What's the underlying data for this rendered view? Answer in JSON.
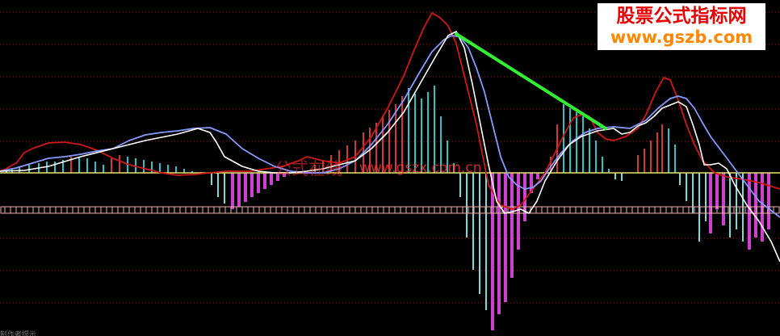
{
  "brand": {
    "name": "股票公式指标网",
    "url": "www.gszb.com"
  },
  "watermark": {
    "text_cn": "公式在线",
    "url": "www.gszx.com.cn"
  },
  "bottom_fragment": "制作者提示",
  "colors": {
    "background": "#000000",
    "kline_red": "#d01818",
    "dea_blue": "#8899ff",
    "dif_white": "#ffffff",
    "trend_green": "#33ee33",
    "zero_line": "#e8e070",
    "band": "#f0b0b0",
    "bar_pos_cyan": "#30c0c8",
    "bar_neg_magenta": "#d040d0",
    "bar_pos_red": "#cc3a3a",
    "bar_neg_cyan": "#7fd8d8",
    "grid": "#8a2020"
  },
  "chart_data": {
    "type": "line",
    "title": "",
    "xlabel": "",
    "ylabel": "",
    "grid": "dotted horizontal red lines",
    "x_count": 120,
    "ylim": [
      -100,
      100
    ],
    "zero_line": 0,
    "series": [
      {
        "name": "",
        "color": "#d01818",
        "points": [
          [
            0,
            2
          ],
          [
            8,
            5
          ],
          [
            12,
            8
          ],
          [
            20,
            12
          ],
          [
            30,
            25
          ],
          [
            40,
            30
          ],
          [
            60,
            37
          ],
          [
            80,
            38
          ],
          [
            100,
            35
          ],
          [
            120,
            28
          ],
          [
            140,
            18
          ],
          [
            160,
            10
          ],
          [
            180,
            5
          ],
          [
            200,
            0
          ],
          [
            220,
            -3
          ],
          [
            240,
            -2
          ],
          [
            260,
            0
          ],
          [
            280,
            2
          ],
          [
            310,
            2
          ],
          [
            330,
            5
          ],
          [
            350,
            8
          ],
          [
            370,
            15
          ],
          [
            380,
            20
          ],
          [
            400,
            15
          ],
          [
            420,
            12
          ],
          [
            440,
            20
          ],
          [
            460,
            45
          ],
          [
            480,
            80
          ],
          [
            500,
            120
          ],
          [
            512,
            150
          ],
          [
            525,
            180
          ],
          [
            535,
            198
          ],
          [
            545,
            192
          ],
          [
            555,
            182
          ],
          [
            565,
            160
          ],
          [
            575,
            120
          ],
          [
            590,
            60
          ],
          [
            605,
            -15
          ],
          [
            620,
            -40
          ],
          [
            635,
            -45
          ],
          [
            645,
            -40
          ],
          [
            660,
            -20
          ],
          [
            675,
            0
          ],
          [
            690,
            30
          ],
          [
            700,
            50
          ],
          [
            710,
            68
          ],
          [
            720,
            72
          ],
          [
            730,
            70
          ],
          [
            740,
            50
          ],
          [
            750,
            42
          ],
          [
            760,
            40
          ],
          [
            775,
            45
          ],
          [
            790,
            55
          ],
          [
            800,
            72
          ],
          [
            812,
            100
          ],
          [
            822,
            118
          ],
          [
            830,
            115
          ],
          [
            840,
            90
          ],
          [
            850,
            60
          ],
          [
            860,
            35
          ],
          [
            870,
            15
          ],
          [
            885,
            0
          ],
          [
            900,
            -5
          ],
          [
            920,
            -8
          ],
          [
            940,
            -12
          ],
          [
            966,
            -20
          ]
        ]
      },
      {
        "name": "",
        "color": "#8899ff",
        "points": [
          [
            0,
            2
          ],
          [
            20,
            6
          ],
          [
            40,
            12
          ],
          [
            60,
            18
          ],
          [
            80,
            20
          ],
          [
            100,
            23
          ],
          [
            120,
            27
          ],
          [
            140,
            30
          ],
          [
            160,
            40
          ],
          [
            180,
            47
          ],
          [
            200,
            50
          ],
          [
            220,
            52
          ],
          [
            240,
            55
          ],
          [
            260,
            56
          ],
          [
            280,
            48
          ],
          [
            300,
            30
          ],
          [
            320,
            18
          ],
          [
            340,
            8
          ],
          [
            360,
            2
          ],
          [
            380,
            0
          ],
          [
            400,
            0
          ],
          [
            420,
            5
          ],
          [
            440,
            15
          ],
          [
            460,
            35
          ],
          [
            480,
            60
          ],
          [
            500,
            90
          ],
          [
            520,
            125
          ],
          [
            535,
            150
          ],
          [
            550,
            165
          ],
          [
            560,
            170
          ],
          [
            570,
            168
          ],
          [
            580,
            155
          ],
          [
            590,
            130
          ],
          [
            600,
            100
          ],
          [
            610,
            60
          ],
          [
            620,
            20
          ],
          [
            630,
            -5
          ],
          [
            640,
            -15
          ],
          [
            650,
            -20
          ],
          [
            660,
            -18
          ],
          [
            670,
            -10
          ],
          [
            680,
            5
          ],
          [
            695,
            25
          ],
          [
            710,
            40
          ],
          [
            725,
            50
          ],
          [
            740,
            55
          ],
          [
            760,
            57
          ],
          [
            780,
            55
          ],
          [
            800,
            65
          ],
          [
            815,
            80
          ],
          [
            830,
            92
          ],
          [
            840,
            95
          ],
          [
            850,
            92
          ],
          [
            860,
            80
          ],
          [
            870,
            62
          ],
          [
            880,
            45
          ],
          [
            895,
            25
          ],
          [
            910,
            5
          ],
          [
            925,
            -15
          ],
          [
            940,
            -35
          ],
          [
            966,
            -55
          ]
        ]
      },
      {
        "name": "",
        "color": "#ffffff",
        "points": [
          [
            0,
            2
          ],
          [
            30,
            3
          ],
          [
            60,
            8
          ],
          [
            100,
            20
          ],
          [
            140,
            30
          ],
          [
            180,
            40
          ],
          [
            220,
            48
          ],
          [
            245,
            55
          ],
          [
            260,
            50
          ],
          [
            268,
            38
          ],
          [
            278,
            20
          ],
          [
            300,
            8
          ],
          [
            320,
            2
          ],
          [
            340,
            0
          ],
          [
            360,
            0
          ],
          [
            380,
            2
          ],
          [
            400,
            5
          ],
          [
            420,
            10
          ],
          [
            440,
            15
          ],
          [
            460,
            30
          ],
          [
            480,
            50
          ],
          [
            500,
            75
          ],
          [
            520,
            110
          ],
          [
            540,
            145
          ],
          [
            555,
            170
          ],
          [
            565,
            175
          ],
          [
            575,
            155
          ],
          [
            585,
            110
          ],
          [
            595,
            60
          ],
          [
            605,
            10
          ],
          [
            615,
            -35
          ],
          [
            625,
            -50
          ],
          [
            635,
            -48
          ],
          [
            645,
            -45
          ],
          [
            655,
            -50
          ],
          [
            665,
            -35
          ],
          [
            675,
            -10
          ],
          [
            690,
            15
          ],
          [
            705,
            35
          ],
          [
            720,
            45
          ],
          [
            740,
            52
          ],
          [
            760,
            55
          ],
          [
            770,
            48
          ],
          [
            780,
            50
          ],
          [
            790,
            58
          ],
          [
            800,
            62
          ],
          [
            810,
            70
          ],
          [
            820,
            80
          ],
          [
            840,
            88
          ],
          [
            850,
            82
          ],
          [
            858,
            60
          ],
          [
            866,
            35
          ],
          [
            872,
            10
          ],
          [
            880,
            10
          ],
          [
            890,
            12
          ],
          [
            900,
            5
          ],
          [
            910,
            -15
          ],
          [
            925,
            -40
          ],
          [
            940,
            -60
          ],
          [
            955,
            -85
          ],
          [
            966,
            -110
          ]
        ]
      }
    ],
    "trend_segment": {
      "from": [
        565,
        172
      ],
      "to": [
        750,
        55
      ]
    },
    "histogram": [
      {
        "x": 8,
        "v": 4,
        "c": "pos_cyan"
      },
      {
        "x": 15,
        "v": 6,
        "c": "pos_cyan"
      },
      {
        "x": 24,
        "v": 8,
        "c": "pos_cyan"
      },
      {
        "x": 36,
        "v": 10,
        "c": "pos_cyan"
      },
      {
        "x": 48,
        "v": 12,
        "c": "pos_cyan"
      },
      {
        "x": 58,
        "v": 14,
        "c": "pos_cyan"
      },
      {
        "x": 68,
        "v": 14,
        "c": "pos_cyan"
      },
      {
        "x": 78,
        "v": 16,
        "c": "pos_cyan"
      },
      {
        "x": 88,
        "v": 20,
        "c": "pos_red"
      },
      {
        "x": 98,
        "v": 20,
        "c": "pos_cyan"
      },
      {
        "x": 108,
        "v": 18,
        "c": "pos_cyan"
      },
      {
        "x": 118,
        "v": 14,
        "c": "pos_cyan"
      },
      {
        "x": 128,
        "v": 10,
        "c": "pos_cyan"
      },
      {
        "x": 138,
        "v": 18,
        "c": "pos_red"
      },
      {
        "x": 148,
        "v": 22,
        "c": "pos_red"
      },
      {
        "x": 158,
        "v": 20,
        "c": "pos_cyan"
      },
      {
        "x": 168,
        "v": 18,
        "c": "pos_cyan"
      },
      {
        "x": 178,
        "v": 16,
        "c": "pos_cyan"
      },
      {
        "x": 188,
        "v": 14,
        "c": "pos_cyan"
      },
      {
        "x": 198,
        "v": 12,
        "c": "pos_cyan"
      },
      {
        "x": 208,
        "v": 10,
        "c": "pos_cyan"
      },
      {
        "x": 218,
        "v": 8,
        "c": "pos_cyan"
      },
      {
        "x": 228,
        "v": 5,
        "c": "pos_cyan"
      },
      {
        "x": 238,
        "v": 2,
        "c": "pos_cyan"
      },
      {
        "x": 262,
        "v": -15,
        "c": "neg_cyan"
      },
      {
        "x": 270,
        "v": -30,
        "c": "neg_cyan"
      },
      {
        "x": 278,
        "v": -38,
        "c": "neg_cyan"
      },
      {
        "x": 288,
        "v": -45,
        "c": "neg_magenta"
      },
      {
        "x": 296,
        "v": -42,
        "c": "neg_magenta"
      },
      {
        "x": 304,
        "v": -36,
        "c": "neg_magenta"
      },
      {
        "x": 312,
        "v": -30,
        "c": "neg_magenta"
      },
      {
        "x": 320,
        "v": -25,
        "c": "neg_magenta"
      },
      {
        "x": 328,
        "v": -20,
        "c": "neg_magenta"
      },
      {
        "x": 336,
        "v": -15,
        "c": "neg_magenta"
      },
      {
        "x": 344,
        "v": -10,
        "c": "neg_magenta"
      },
      {
        "x": 352,
        "v": -5,
        "c": "neg_magenta"
      },
      {
        "x": 390,
        "v": 10,
        "c": "pos_red"
      },
      {
        "x": 400,
        "v": 16,
        "c": "pos_red"
      },
      {
        "x": 410,
        "v": 22,
        "c": "pos_red"
      },
      {
        "x": 420,
        "v": 28,
        "c": "pos_red"
      },
      {
        "x": 430,
        "v": 34,
        "c": "pos_red"
      },
      {
        "x": 440,
        "v": 40,
        "c": "pos_red"
      },
      {
        "x": 450,
        "v": 50,
        "c": "pos_red"
      },
      {
        "x": 458,
        "v": 56,
        "c": "pos_red"
      },
      {
        "x": 466,
        "v": 62,
        "c": "pos_red"
      },
      {
        "x": 474,
        "v": 70,
        "c": "pos_red"
      },
      {
        "x": 482,
        "v": 78,
        "c": "pos_red"
      },
      {
        "x": 490,
        "v": 85,
        "c": "pos_red"
      },
      {
        "x": 498,
        "v": 95,
        "c": "pos_red"
      },
      {
        "x": 506,
        "v": 105,
        "c": "pos_cyan"
      },
      {
        "x": 514,
        "v": 98,
        "c": "pos_cyan"
      },
      {
        "x": 522,
        "v": 92,
        "c": "pos_cyan"
      },
      {
        "x": 530,
        "v": 100,
        "c": "pos_cyan"
      },
      {
        "x": 538,
        "v": 108,
        "c": "pos_cyan"
      },
      {
        "x": 546,
        "v": 70,
        "c": "pos_cyan"
      },
      {
        "x": 554,
        "v": 40,
        "c": "pos_cyan"
      },
      {
        "x": 562,
        "v": 12,
        "c": "pos_cyan"
      },
      {
        "x": 570,
        "v": -30,
        "c": "neg_cyan"
      },
      {
        "x": 578,
        "v": -80,
        "c": "neg_cyan"
      },
      {
        "x": 586,
        "v": -120,
        "c": "neg_cyan"
      },
      {
        "x": 594,
        "v": -150,
        "c": "neg_cyan"
      },
      {
        "x": 602,
        "v": -170,
        "c": "neg_cyan"
      },
      {
        "x": 610,
        "v": -195,
        "c": "neg_magenta"
      },
      {
        "x": 618,
        "v": -175,
        "c": "neg_magenta"
      },
      {
        "x": 626,
        "v": -160,
        "c": "neg_magenta"
      },
      {
        "x": 634,
        "v": -130,
        "c": "neg_magenta"
      },
      {
        "x": 642,
        "v": -95,
        "c": "neg_magenta"
      },
      {
        "x": 650,
        "v": -60,
        "c": "neg_magenta"
      },
      {
        "x": 658,
        "v": -25,
        "c": "neg_magenta"
      },
      {
        "x": 666,
        "v": -8,
        "c": "neg_magenta"
      },
      {
        "x": 682,
        "v": 20,
        "c": "pos_red"
      },
      {
        "x": 690,
        "v": 60,
        "c": "pos_red"
      },
      {
        "x": 698,
        "v": 85,
        "c": "pos_cyan"
      },
      {
        "x": 706,
        "v": 80,
        "c": "pos_cyan"
      },
      {
        "x": 714,
        "v": 75,
        "c": "pos_cyan"
      },
      {
        "x": 722,
        "v": 70,
        "c": "pos_cyan"
      },
      {
        "x": 730,
        "v": 55,
        "c": "pos_cyan"
      },
      {
        "x": 738,
        "v": 40,
        "c": "pos_cyan"
      },
      {
        "x": 746,
        "v": 20,
        "c": "pos_cyan"
      },
      {
        "x": 754,
        "v": 5,
        "c": "pos_cyan"
      },
      {
        "x": 762,
        "v": -8,
        "c": "neg_cyan"
      },
      {
        "x": 770,
        "v": -10,
        "c": "neg_cyan"
      },
      {
        "x": 790,
        "v": 22,
        "c": "pos_red"
      },
      {
        "x": 798,
        "v": 30,
        "c": "pos_red"
      },
      {
        "x": 806,
        "v": 40,
        "c": "pos_red"
      },
      {
        "x": 814,
        "v": 50,
        "c": "pos_red"
      },
      {
        "x": 820,
        "v": 60,
        "c": "pos_red"
      },
      {
        "x": 828,
        "v": 55,
        "c": "pos_cyan"
      },
      {
        "x": 836,
        "v": 35,
        "c": "pos_cyan"
      },
      {
        "x": 842,
        "v": -15,
        "c": "neg_cyan"
      },
      {
        "x": 850,
        "v": -35,
        "c": "neg_cyan"
      },
      {
        "x": 858,
        "v": -50,
        "c": "neg_cyan"
      },
      {
        "x": 866,
        "v": -85,
        "c": "neg_cyan"
      },
      {
        "x": 874,
        "v": -60,
        "c": "neg_cyan"
      },
      {
        "x": 880,
        "v": -75,
        "c": "neg_magenta"
      },
      {
        "x": 888,
        "v": -45,
        "c": "neg_magenta"
      },
      {
        "x": 896,
        "v": -65,
        "c": "neg_magenta"
      },
      {
        "x": 904,
        "v": -80,
        "c": "neg_cyan"
      },
      {
        "x": 912,
        "v": -70,
        "c": "neg_cyan"
      },
      {
        "x": 920,
        "v": -85,
        "c": "neg_cyan"
      },
      {
        "x": 928,
        "v": -95,
        "c": "neg_magenta"
      },
      {
        "x": 936,
        "v": -80,
        "c": "neg_magenta"
      },
      {
        "x": 944,
        "v": -85,
        "c": "neg_magenta"
      },
      {
        "x": 952,
        "v": -70,
        "c": "neg_magenta"
      }
    ]
  }
}
